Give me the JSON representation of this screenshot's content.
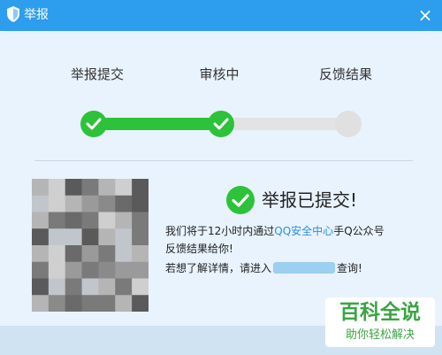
{
  "window": {
    "title": "举报",
    "close_symbol": "×"
  },
  "steps": [
    {
      "label": "举报提交",
      "state": "done"
    },
    {
      "label": "审核中",
      "state": "done"
    },
    {
      "label": "反馈结果",
      "state": "pending"
    }
  ],
  "progress": {
    "completed_steps": 2,
    "total_steps": 3
  },
  "result": {
    "title": "举报已提交!",
    "line1_before": "我们将于12小时内通过",
    "line1_link": "QQ安全中心",
    "line1_after": "手Q公众号",
    "line2": "反馈结果给你!",
    "line3_before": "若想了解详情，请进入",
    "line3_after": "查询!"
  },
  "watermark": {
    "title": "百科全说",
    "subtitle": "助你轻松解决"
  },
  "colors": {
    "titlebar": "#2d9ded",
    "success_green": "#2dc23a",
    "link_blue": "#2d8ee4",
    "background": "#e8f3fd"
  }
}
